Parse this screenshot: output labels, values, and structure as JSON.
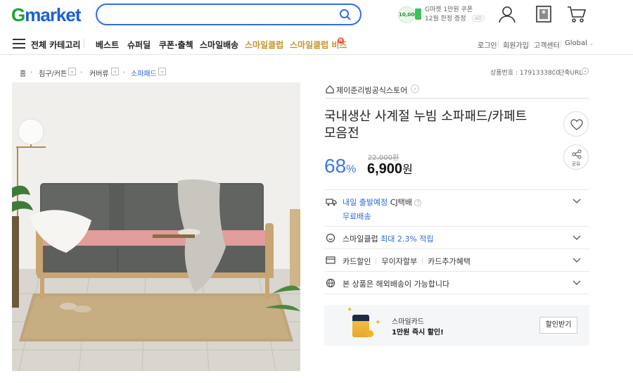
{
  "header": {
    "logo_g": "G",
    "logo_rest": "market",
    "search": {
      "value": "",
      "placeholder": ""
    },
    "promo": {
      "coin_text": "10,000",
      "line1": "G마켓 1만원 쿠폰",
      "line2": "12월 한정 증정",
      "ad": "AD"
    }
  },
  "nav": {
    "all_categories": "전체 카테고리",
    "items": [
      "베스트",
      "슈퍼딜",
      "쿠폰·출첵",
      "스마일배송",
      "스마일클럽",
      "스마일클럽 비즈"
    ],
    "badge": "N",
    "util": [
      "로그인",
      "회원가입",
      "고객센터",
      "Global"
    ]
  },
  "breadcrumb": {
    "home": "홈",
    "items": [
      "침구/커튼",
      "커버류",
      "소파패드"
    ],
    "product_no": "상품번호 : 1791333800",
    "short_url": "단축URL"
  },
  "product": {
    "store_name": "제이준리빙공식스토어",
    "title": "국내생산 사계절 누빔 소파패드/카페트 모음전",
    "discount": "68",
    "discount_unit": "%",
    "original_price": "22,000원",
    "price": "6,900",
    "price_unit": "원",
    "share_label": "공유"
  },
  "info_rows": {
    "delivery_main": "내일 출발예정",
    "delivery_carrier": " CJ택배",
    "delivery_free": "무료배송",
    "smile_prefix": "스마일클럽 ",
    "smile_highlight": "최대 2.3% 적립",
    "card_items": [
      "카드할인",
      "무이자할부",
      "카드추가혜택"
    ],
    "overseas": "본 상품은 해외배송이 가능합니다"
  },
  "card_promo": {
    "line1": "스마일카드",
    "line2": "1만원 즉시 할인!",
    "button": "할인받기"
  },
  "colors": {
    "brand_green": "#19a431",
    "brand_blue": "#1b5fd6",
    "link_blue": "#2d6ae3",
    "gold": "#c6922b"
  }
}
